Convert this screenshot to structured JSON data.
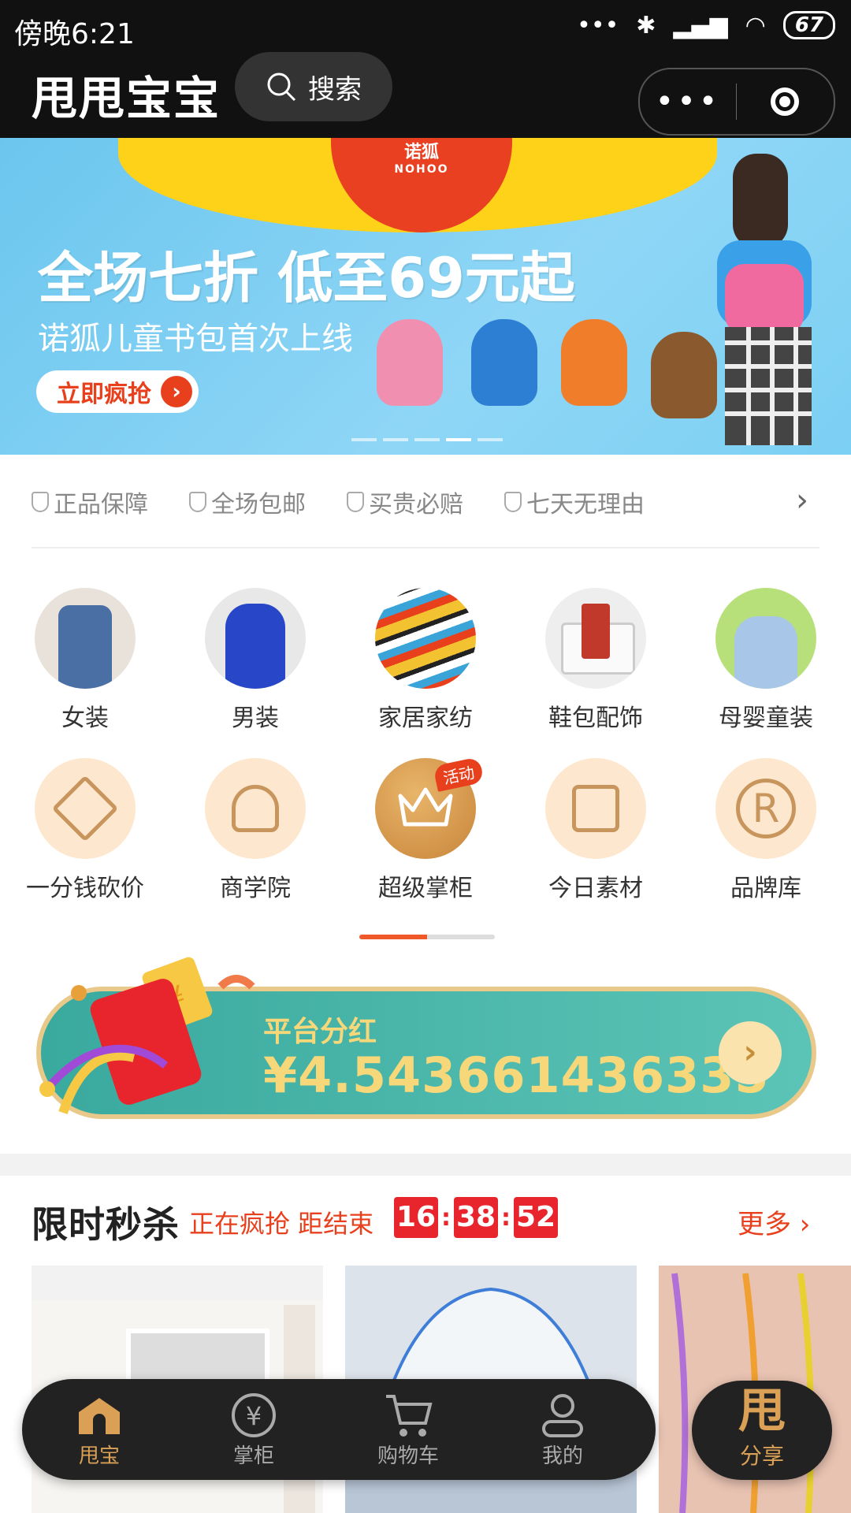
{
  "status_bar": {
    "time": "傍晚6:21",
    "signal_dots": "•••",
    "battery": "67"
  },
  "header": {
    "app_title": "甩甩宝宝",
    "search_label": "搜索",
    "more_label": "•••"
  },
  "banner": {
    "brand_cn": "诺狐",
    "brand_en": "NOHOO",
    "headline": "全场七折 低至69元起",
    "subtitle": "诺狐儿童书包首次上线",
    "cta": "立即疯抢",
    "page_count": 5,
    "active_page_index": 3
  },
  "guarantees": [
    "正品保障",
    "全场包邮",
    "买贵必赔",
    "七天无理由"
  ],
  "categories": [
    {
      "label": "女装",
      "icon": "womens-coat",
      "color": "#4a6fa5"
    },
    {
      "label": "男装",
      "icon": "mens-hoodie",
      "color": "#2846c8"
    },
    {
      "label": "家居家纺",
      "icon": "bedding",
      "color": "#f2c230"
    },
    {
      "label": "鞋包配饰",
      "icon": "handbag",
      "color": "#c0392b"
    },
    {
      "label": "母婴童装",
      "icon": "baby-clothes",
      "color": "#a7d4f0"
    }
  ],
  "tools": [
    {
      "label": "一分钱砍价",
      "icon": "price-tag-icon"
    },
    {
      "label": "商学院",
      "icon": "user-star-icon"
    },
    {
      "label": "超级掌柜",
      "icon": "crown-icon",
      "badge": "活动"
    },
    {
      "label": "今日素材",
      "icon": "image-icon"
    },
    {
      "label": "品牌库",
      "icon": "registered-icon"
    }
  ],
  "grid_pager": {
    "progress": 0.5
  },
  "dividend": {
    "label": "平台分红",
    "amount": "¥4.543661436335"
  },
  "flash_sale": {
    "title": "限时秒杀",
    "status": "正在疯抢 距结束",
    "hours": "16",
    "minutes": "38",
    "seconds": "52",
    "more": "更多"
  },
  "tabbar": {
    "tabs": [
      {
        "label": "甩宝",
        "icon": "home-icon",
        "active": true
      },
      {
        "label": "掌柜",
        "icon": "yen-icon",
        "active": false
      },
      {
        "label": "购物车",
        "icon": "cart-icon",
        "active": false
      },
      {
        "label": "我的",
        "icon": "user-icon",
        "active": false
      }
    ],
    "share": {
      "label": "分享",
      "glyph": "甩"
    }
  },
  "colors": {
    "accent": "#e8401d",
    "gold": "#d9a056",
    "teal": "#4bb8aa",
    "dark": "#111111"
  }
}
